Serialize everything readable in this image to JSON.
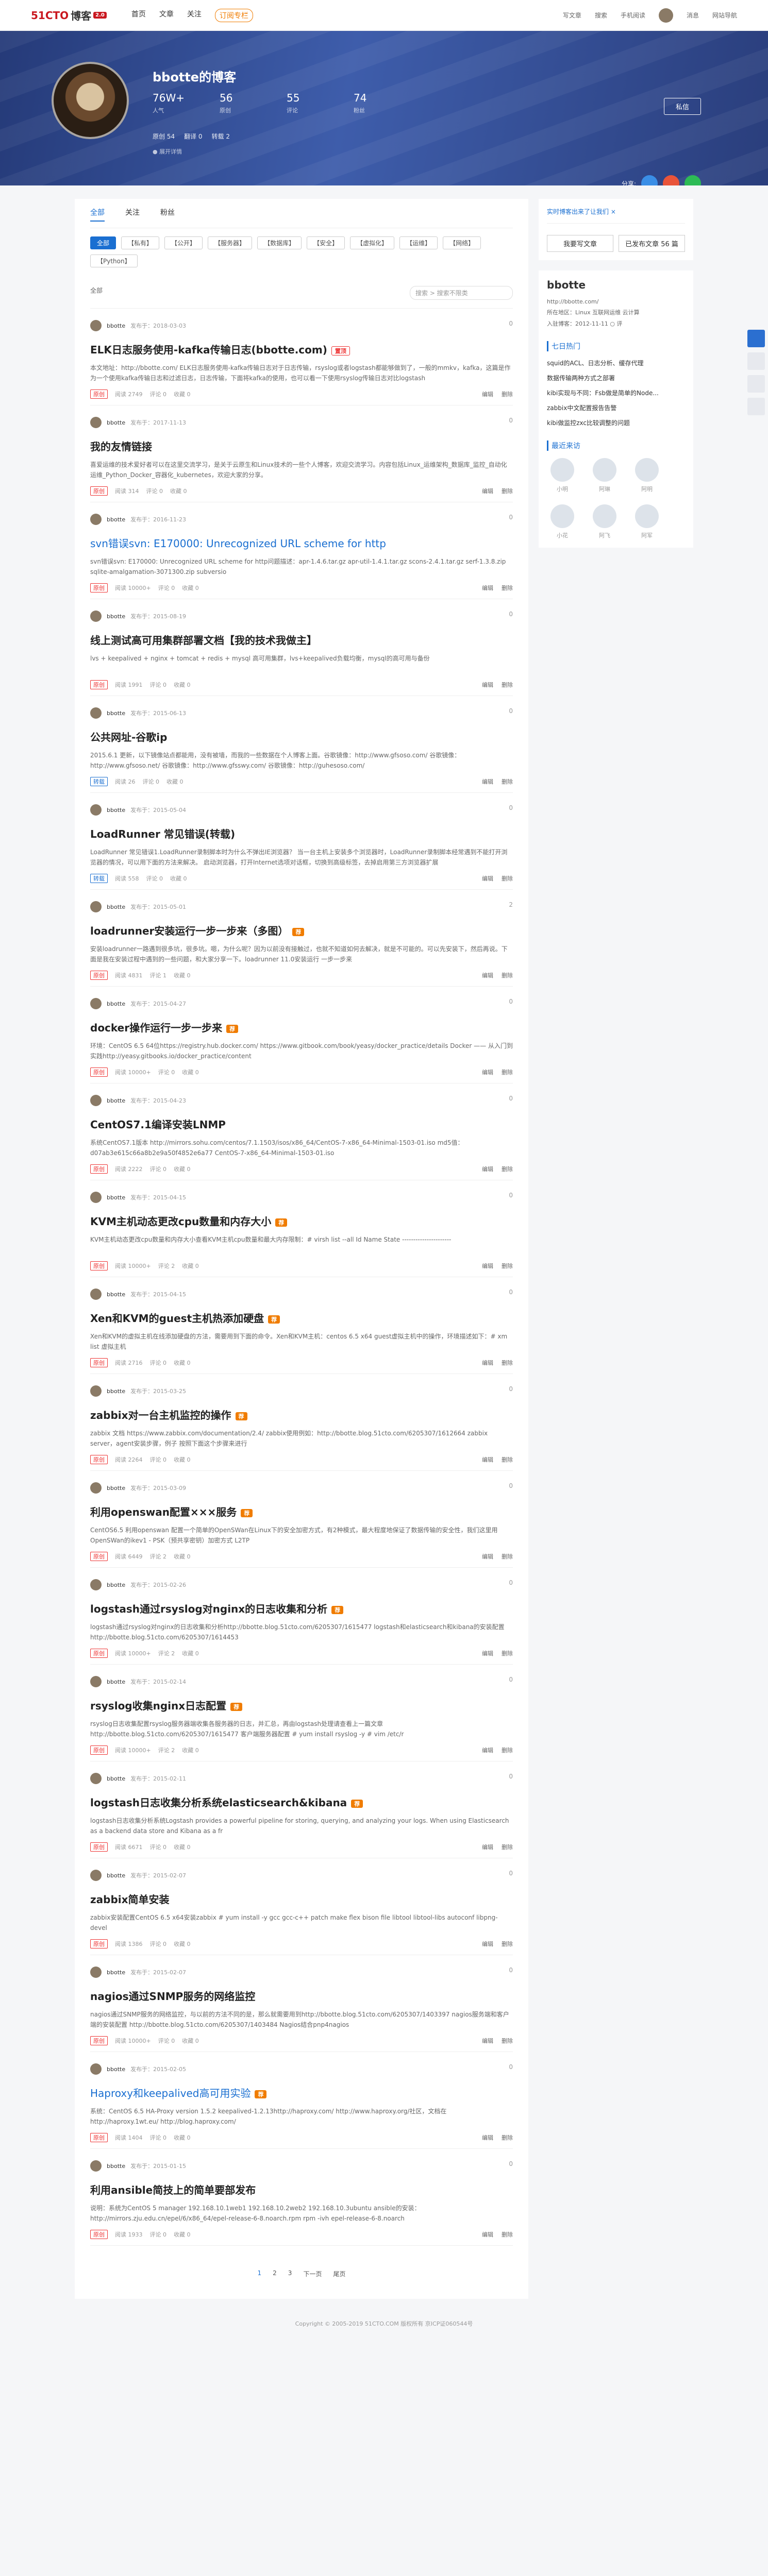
{
  "header": {
    "logo_a": "51CTO",
    "logo_b": "博客",
    "logo_badge": "2.0",
    "nav": [
      "首页",
      "文章",
      "关注",
      "订阅专栏"
    ],
    "right": [
      "写文章",
      "搜索",
      "手机阅读",
      "消息",
      "网站导航"
    ]
  },
  "hero": {
    "name": "bbotte的博客",
    "stats": [
      {
        "n": "76W+",
        "l": "人气"
      },
      {
        "n": "56",
        "l": "原创"
      },
      {
        "n": "55",
        "l": "评论"
      },
      {
        "n": "74",
        "l": "粉丝"
      }
    ],
    "meta": [
      "原创 54",
      "翻译 0",
      "转载 2"
    ],
    "more": "● 展开详情",
    "follow": "私信",
    "share": "分享:"
  },
  "tabs": [
    "全部",
    "关注",
    "粉丝"
  ],
  "categories": [
    "全部",
    "【私有】",
    "【公开】",
    "【服务器】",
    "【数据库】",
    "【安全】",
    "【虚拟化】",
    "【运维】",
    "【网络】",
    "【Python】"
  ],
  "filter": {
    "order": "全部",
    "search": "搜索 > 搜索不限类"
  },
  "posts": [
    {
      "author": "bbotte",
      "date": "发布于：2018-03-03",
      "likes": "0",
      "title": "ELK日志服务使用-kafka传输日志(bbotte.com)",
      "tag": "置顶",
      "tagtype": "hot",
      "blue": false,
      "excerpt": "本文地址：http://bbotte.com/  ELK日志服务使用-kafka传输日志对于日志传输，rsyslog或者logstash都能够做到了，一般的mmkv，kafka，这篇是作为一个使用kafka传输日志和过滤日志，日志传输，下面将kafka的使用，也可以看一下使用rsyslog传输日志对比logstash",
      "type": "原创",
      "read": "阅读 2749",
      "comment": "评论 0",
      "fav": "收藏 0"
    },
    {
      "author": "bbotte",
      "date": "发布于：2017-11-13",
      "likes": "0",
      "title": "我的友情链接",
      "tag": "",
      "tagtype": "",
      "blue": false,
      "excerpt": "喜爱运维的技术爱好者可以在这里交流学习，是关于云原生和Linux技术的一些个人博客，欢迎交流学习。内容包括Linux_运维架构_数据库_监控_自动化运维_Python_Docker_容器化_kubernetes，欢迎大家的分享。",
      "type": "原创",
      "read": "阅读 314",
      "comment": "评论 0",
      "fav": "收藏 0"
    },
    {
      "author": "bbotte",
      "date": "发布于：2016-11-23",
      "likes": "0",
      "title": "svn错误svn: E170000: Unrecognized URL scheme for http",
      "tag": "",
      "tagtype": "",
      "blue": true,
      "excerpt": "svn错误svn: E170000: Unrecognized URL scheme for http问题描述：apr-1.4.6.tar.gz  apr-util-1.4.1.tar.gz  scons-2.4.1.tar.gz  serf-1.3.8.zip  sqlite-amalgamation-3071300.zip  subversio",
      "type": "原创",
      "read": "阅读 10000+",
      "comment": "评论 0",
      "fav": "收藏 0"
    },
    {
      "author": "bbotte",
      "date": "发布于：2015-08-19",
      "likes": "0",
      "title": "线上测试高可用集群部署文档【我的技术我做主】",
      "tag": "",
      "tagtype": "",
      "blue": false,
      "excerpt": "lvs + keepalived + nginx + tomcat + redis + mysql 高可用集群，lvs+keepalived负载均衡，mysql的高可用与备份",
      "type": "原创",
      "read": "阅读 1991",
      "comment": "评论 0",
      "fav": "收藏 0"
    },
    {
      "author": "bbotte",
      "date": "发布于：2015-06-13",
      "likes": "0",
      "title": "公共网址-谷歌ip",
      "tag": "",
      "tagtype": "",
      "blue": false,
      "excerpt": "2015.6.1 更新，以下镜像站点都能用，没有被墙，而我的一些数据在个人博客上面。谷歌镜像：http://www.gfsoso.com/  谷歌镜像：http://www.gfsoso.net/  谷歌镜像：http://www.gfsswy.com/  谷歌镜像：http://guhesoso.com/",
      "type": "转载",
      "read": "阅读 26",
      "comment": "评论 0",
      "fav": "收藏 0"
    },
    {
      "author": "bbotte",
      "date": "发布于：2015-05-04",
      "likes": "0",
      "title": "LoadRunner 常见错误(转载)",
      "tag": "",
      "tagtype": "",
      "blue": false,
      "excerpt": "LoadRunner 常见错误1.LoadRunner录制脚本时为什么不弹出IE浏览器？  当一台主机上安装多个浏览器时，LoadRunner录制脚本经常遇到不能打开浏览器的情况，可以用下面的方法来解决。  启动浏览器，打开Internet选项对话框，切换到高级标签，去掉启用第三方浏览器扩展",
      "type": "转载",
      "read": "阅读 558",
      "comment": "评论 0",
      "fav": "收藏 0"
    },
    {
      "author": "bbotte",
      "date": "发布于：2015-05-01",
      "likes": "2",
      "title": "loadrunner安装运行一步一步来（多图）",
      "tag": "荐",
      "tagtype": "rec",
      "blue": false,
      "excerpt": "安装loadrunner一路遇到很多坑，很多坑。嗯，为什么呢？因为以前没有接触过，也就不知道如何去解决，就是不可能的。可以先安装下，然后再说。下面是我在安装过程中遇到的一些问题，和大家分享一下。loadrunner 11.0安装运行 一步一步来",
      "type": "原创",
      "read": "阅读 4831",
      "comment": "评论 1",
      "fav": "收藏 0"
    },
    {
      "author": "bbotte",
      "date": "发布于：2015-04-27",
      "likes": "0",
      "title": "docker操作运行一步一步来",
      "tag": "荐",
      "tagtype": "rec",
      "blue": false,
      "excerpt": "环境：CentOS 6.5 64位https://registry.hub.docker.com/  https://www.gitbook.com/book/yeasy/docker_practice/details  Docker —— 从入门到实践http://yeasy.gitbooks.io/docker_practice/content",
      "type": "原创",
      "read": "阅读 10000+",
      "comment": "评论 0",
      "fav": "收藏 0"
    },
    {
      "author": "bbotte",
      "date": "发布于：2015-04-23",
      "likes": "0",
      "title": "CentOS7.1编译安装LNMP",
      "tag": "",
      "tagtype": "",
      "blue": false,
      "excerpt": "系统CentOS7.1版本 http://mirrors.sohu.com/centos/7.1.1503/isos/x86_64/CentOS-7-x86_64-Minimal-1503-01.iso  md5值：d07ab3e615c66a8b2e9a50f4852e6a77  CentOS-7-x86_64-Minimal-1503-01.iso",
      "type": "原创",
      "read": "阅读 2222",
      "comment": "评论 0",
      "fav": "收藏 0"
    },
    {
      "author": "bbotte",
      "date": "发布于：2015-04-15",
      "likes": "0",
      "title": "KVM主机动态更改cpu数量和内存大小",
      "tag": "荐",
      "tagtype": "rec",
      "blue": false,
      "excerpt": "KVM主机动态更改cpu数量和内存大小查看KVM主机cpu数量和最大内存限制：# virsh list --all  Id    Name     State  ----------------------",
      "type": "原创",
      "read": "阅读 10000+",
      "comment": "评论 2",
      "fav": "收藏 0"
    },
    {
      "author": "bbotte",
      "date": "发布于：2015-04-15",
      "likes": "0",
      "title": "Xen和KVM的guest主机热添加硬盘",
      "tag": "荐",
      "tagtype": "rec",
      "blue": false,
      "excerpt": "Xen和KVM的虚拟主机在线添加硬盘的方法，需要用到下面的命令。Xen和KVM主机：centos 6.5 x64 guest虚拟主机中的操作，环境描述如下：# xm list  虚拟主机",
      "type": "原创",
      "read": "阅读 2716",
      "comment": "评论 0",
      "fav": "收藏 0"
    },
    {
      "author": "bbotte",
      "date": "发布于：2015-03-25",
      "likes": "0",
      "title": "zabbix对一台主机监控的操作",
      "tag": "荐",
      "tagtype": "rec",
      "blue": false,
      "excerpt": "zabbix 文档 https://www.zabbix.com/documentation/2.4/  zabbix使用例如：http://bbotte.blog.51cto.com/6205307/1612664  zabbix server，agent安装步骤，例子 按照下面这个步骤来进行",
      "type": "原创",
      "read": "阅读 2264",
      "comment": "评论 0",
      "fav": "收藏 0"
    },
    {
      "author": "bbotte",
      "date": "发布于：2015-03-09",
      "likes": "0",
      "title": "利用openswan配置×××服务",
      "tag": "荐",
      "tagtype": "rec",
      "blue": false,
      "excerpt": "CentOS6.5 利用openswan 配置一个简单的OpenSWan在Linux下的安全加密方式，有2种模式，最大程度地保证了数据传输的安全性，我们这里用OpenSWan的ikev1 - PSK（预共享密钥）加密方式 L2TP",
      "type": "原创",
      "read": "阅读 6449",
      "comment": "评论 2",
      "fav": "收藏 0"
    },
    {
      "author": "bbotte",
      "date": "发布于：2015-02-26",
      "likes": "0",
      "title": "logstash通过rsyslog对nginx的日志收集和分析",
      "tag": "荐",
      "tagtype": "rec",
      "blue": false,
      "excerpt": "logstash通过rsyslog对nginx的日志收集和分析http://bbotte.blog.51cto.com/6205307/1615477  logstash和elasticsearch和kibana的安装配置 http://bbotte.blog.51cto.com/6205307/1614453",
      "type": "原创",
      "read": "阅读 10000+",
      "comment": "评论 2",
      "fav": "收藏 0"
    },
    {
      "author": "bbotte",
      "date": "发布于：2015-02-14",
      "likes": "0",
      "title": "rsyslog收集nginx日志配置",
      "tag": "荐",
      "tagtype": "rec",
      "blue": false,
      "excerpt": "rsyslog日志收集配置rsyslog服务器端收集各服务器的日志，并汇总，再由logstash处理请查看上一篇文章 http://bbotte.blog.51cto.com/6205307/1615477 客户端服务器配置 # yum install rsyslog -y  # vim /etc/r",
      "type": "原创",
      "read": "阅读 10000+",
      "comment": "评论 2",
      "fav": "收藏 0"
    },
    {
      "author": "bbotte",
      "date": "发布于：2015-02-11",
      "likes": "0",
      "title": "logstash日志收集分析系统elasticsearch&kibana",
      "tag": "荐",
      "tagtype": "rec",
      "blue": false,
      "excerpt": "logstash日志收集分析系统Logstash provides a powerful pipeline for storing, querying, and analyzing your logs. When using Elasticsearch as a backend data store and Kibana as a fr",
      "type": "原创",
      "read": "阅读 6671",
      "comment": "评论 0",
      "fav": "收藏 0"
    },
    {
      "author": "bbotte",
      "date": "发布于：2015-02-07",
      "likes": "0",
      "title": "zabbix简单安装",
      "tag": "",
      "tagtype": "",
      "blue": false,
      "excerpt": "zabbix安装配置CentOS 6.5 x64安装zabbix  # yum install -y gcc gcc-c++ patch make flex bison file libtool libtool-libs autoconf libpng-devel",
      "type": "原创",
      "read": "阅读 1386",
      "comment": "评论 0",
      "fav": "收藏 0"
    },
    {
      "author": "bbotte",
      "date": "发布于：2015-02-07",
      "likes": "0",
      "title": "nagios通过SNMP服务的网络监控",
      "tag": "",
      "tagtype": "",
      "blue": false,
      "excerpt": "nagios通过SNMP服务的网络监控，与以前的方法不同的是，那么就需要用到http://bbotte.blog.51cto.com/6205307/1403397 nagios服务端和客户端的安装配置 http://bbotte.blog.51cto.com/6205307/1403484 Nagios结合pnp4nagios",
      "type": "原创",
      "read": "阅读 10000+",
      "comment": "评论 0",
      "fav": "收藏 0"
    },
    {
      "author": "bbotte",
      "date": "发布于：2015-02-05",
      "likes": "0",
      "title": "Haproxy和keepalived高可用实验",
      "tag": "荐",
      "tagtype": "rec",
      "blue": true,
      "excerpt": "系统：CentOS 6.5    HA-Proxy version 1.5.2    keepalived-1.2.13http://haproxy.com/  http://www.haproxy.org/社区，文档在http://haproxy.1wt.eu/  http://blog.haproxy.com/",
      "type": "原创",
      "read": "阅读 1404",
      "comment": "评论 0",
      "fav": "收藏 0"
    },
    {
      "author": "bbotte",
      "date": "发布于：2015-01-15",
      "likes": "0",
      "title": "利用ansible简技上的简单要部发布",
      "tag": "",
      "tagtype": "",
      "blue": false,
      "excerpt": "说明：系统为CentOS 5 manager 192.168.10.1web1 192.168.10.2web2 192.168.10.3ubuntu ansible的安装：http://mirrors.zju.edu.cn/epel/6/x86_64/epel-release-6-8.noarch.rpm rpm -ivh epel-release-6-8.noarch",
      "type": "原创",
      "read": "阅读 1933",
      "comment": "评论 0",
      "fav": "收藏 0"
    }
  ],
  "post_ops": {
    "edit": "编辑",
    "del": "删除"
  },
  "pager": [
    "1",
    "2",
    "3",
    "下一页",
    "尾页"
  ],
  "side": {
    "notice": "实时博客出来了让我们 ×",
    "btn1": "我要写文章",
    "btn2": "已发布文章 56 篇",
    "name": "bbotte",
    "url": "http://bbotte.com/",
    "lines": [
      "所在地区：Linux 互联网运维 云计算",
      "入驻博客：2012-11-11 ○ 评"
    ],
    "hot_title": "七日热门",
    "hot": [
      "squid的ACL、日志分析、缓存代理",
      "数据传输两种方式之部署",
      "kibi实现与不同：Fsb做是简单的Node...",
      "zabbix中文配置报告告警",
      "kibi做监控zxc比较调整的问题"
    ],
    "vis_title": "最近来访",
    "visitors": [
      "小明",
      "阿琳",
      "阿明",
      "小花",
      "阿飞",
      "阿军"
    ]
  },
  "footer": "Copyright © 2005-2019 51CTO.COM 版权所有 京ICP证060544号"
}
